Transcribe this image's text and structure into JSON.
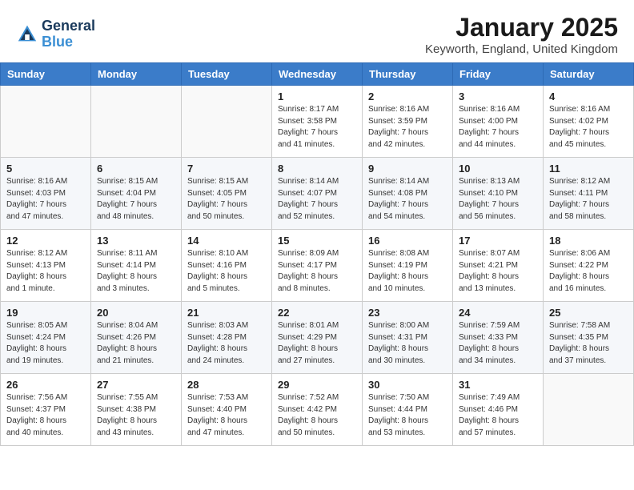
{
  "logo": {
    "line1": "General",
    "line2": "Blue"
  },
  "title": "January 2025",
  "location": "Keyworth, England, United Kingdom",
  "days_of_week": [
    "Sunday",
    "Monday",
    "Tuesday",
    "Wednesday",
    "Thursday",
    "Friday",
    "Saturday"
  ],
  "weeks": [
    [
      {
        "day": "",
        "info": ""
      },
      {
        "day": "",
        "info": ""
      },
      {
        "day": "",
        "info": ""
      },
      {
        "day": "1",
        "info": "Sunrise: 8:17 AM\nSunset: 3:58 PM\nDaylight: 7 hours\nand 41 minutes."
      },
      {
        "day": "2",
        "info": "Sunrise: 8:16 AM\nSunset: 3:59 PM\nDaylight: 7 hours\nand 42 minutes."
      },
      {
        "day": "3",
        "info": "Sunrise: 8:16 AM\nSunset: 4:00 PM\nDaylight: 7 hours\nand 44 minutes."
      },
      {
        "day": "4",
        "info": "Sunrise: 8:16 AM\nSunset: 4:02 PM\nDaylight: 7 hours\nand 45 minutes."
      }
    ],
    [
      {
        "day": "5",
        "info": "Sunrise: 8:16 AM\nSunset: 4:03 PM\nDaylight: 7 hours\nand 47 minutes."
      },
      {
        "day": "6",
        "info": "Sunrise: 8:15 AM\nSunset: 4:04 PM\nDaylight: 7 hours\nand 48 minutes."
      },
      {
        "day": "7",
        "info": "Sunrise: 8:15 AM\nSunset: 4:05 PM\nDaylight: 7 hours\nand 50 minutes."
      },
      {
        "day": "8",
        "info": "Sunrise: 8:14 AM\nSunset: 4:07 PM\nDaylight: 7 hours\nand 52 minutes."
      },
      {
        "day": "9",
        "info": "Sunrise: 8:14 AM\nSunset: 4:08 PM\nDaylight: 7 hours\nand 54 minutes."
      },
      {
        "day": "10",
        "info": "Sunrise: 8:13 AM\nSunset: 4:10 PM\nDaylight: 7 hours\nand 56 minutes."
      },
      {
        "day": "11",
        "info": "Sunrise: 8:12 AM\nSunset: 4:11 PM\nDaylight: 7 hours\nand 58 minutes."
      }
    ],
    [
      {
        "day": "12",
        "info": "Sunrise: 8:12 AM\nSunset: 4:13 PM\nDaylight: 8 hours\nand 1 minute."
      },
      {
        "day": "13",
        "info": "Sunrise: 8:11 AM\nSunset: 4:14 PM\nDaylight: 8 hours\nand 3 minutes."
      },
      {
        "day": "14",
        "info": "Sunrise: 8:10 AM\nSunset: 4:16 PM\nDaylight: 8 hours\nand 5 minutes."
      },
      {
        "day": "15",
        "info": "Sunrise: 8:09 AM\nSunset: 4:17 PM\nDaylight: 8 hours\nand 8 minutes."
      },
      {
        "day": "16",
        "info": "Sunrise: 8:08 AM\nSunset: 4:19 PM\nDaylight: 8 hours\nand 10 minutes."
      },
      {
        "day": "17",
        "info": "Sunrise: 8:07 AM\nSunset: 4:21 PM\nDaylight: 8 hours\nand 13 minutes."
      },
      {
        "day": "18",
        "info": "Sunrise: 8:06 AM\nSunset: 4:22 PM\nDaylight: 8 hours\nand 16 minutes."
      }
    ],
    [
      {
        "day": "19",
        "info": "Sunrise: 8:05 AM\nSunset: 4:24 PM\nDaylight: 8 hours\nand 19 minutes."
      },
      {
        "day": "20",
        "info": "Sunrise: 8:04 AM\nSunset: 4:26 PM\nDaylight: 8 hours\nand 21 minutes."
      },
      {
        "day": "21",
        "info": "Sunrise: 8:03 AM\nSunset: 4:28 PM\nDaylight: 8 hours\nand 24 minutes."
      },
      {
        "day": "22",
        "info": "Sunrise: 8:01 AM\nSunset: 4:29 PM\nDaylight: 8 hours\nand 27 minutes."
      },
      {
        "day": "23",
        "info": "Sunrise: 8:00 AM\nSunset: 4:31 PM\nDaylight: 8 hours\nand 30 minutes."
      },
      {
        "day": "24",
        "info": "Sunrise: 7:59 AM\nSunset: 4:33 PM\nDaylight: 8 hours\nand 34 minutes."
      },
      {
        "day": "25",
        "info": "Sunrise: 7:58 AM\nSunset: 4:35 PM\nDaylight: 8 hours\nand 37 minutes."
      }
    ],
    [
      {
        "day": "26",
        "info": "Sunrise: 7:56 AM\nSunset: 4:37 PM\nDaylight: 8 hours\nand 40 minutes."
      },
      {
        "day": "27",
        "info": "Sunrise: 7:55 AM\nSunset: 4:38 PM\nDaylight: 8 hours\nand 43 minutes."
      },
      {
        "day": "28",
        "info": "Sunrise: 7:53 AM\nSunset: 4:40 PM\nDaylight: 8 hours\nand 47 minutes."
      },
      {
        "day": "29",
        "info": "Sunrise: 7:52 AM\nSunset: 4:42 PM\nDaylight: 8 hours\nand 50 minutes."
      },
      {
        "day": "30",
        "info": "Sunrise: 7:50 AM\nSunset: 4:44 PM\nDaylight: 8 hours\nand 53 minutes."
      },
      {
        "day": "31",
        "info": "Sunrise: 7:49 AM\nSunset: 4:46 PM\nDaylight: 8 hours\nand 57 minutes."
      },
      {
        "day": "",
        "info": ""
      }
    ]
  ]
}
